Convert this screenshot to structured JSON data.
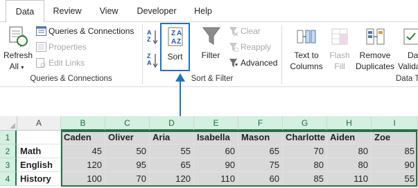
{
  "tabs": [
    "Data",
    "Review",
    "View",
    "Developer",
    "Help"
  ],
  "active_tab": "Data",
  "ribbon": {
    "refresh_label": "Refresh",
    "refresh_all_label": "All",
    "queries_connections": "Queries & Connections",
    "properties": "Properties",
    "edit_links": "Edit Links",
    "group_queries": "Queries & Connections",
    "sort_label": "Sort",
    "filter_label": "Filter",
    "clear_label": "Clear",
    "reapply_label": "Reapply",
    "advanced_label": "Advanced",
    "group_sort_filter": "Sort & Filter",
    "text_to_label": "Text to",
    "columns_label": "Columns",
    "flash_label": "Flash",
    "fill_label": "Fill",
    "remove_label": "Remove",
    "duplicates_label": "Duplicates",
    "data_val_1": "Da",
    "data_val_2": "Valida",
    "group_data_tools": "Data T",
    "sort_az_top": "A",
    "sort_az_bottom": "Z",
    "sort_za_top": "Z",
    "sort_za_bottom": "A"
  },
  "sheet": {
    "columns": [
      "A",
      "B",
      "C",
      "D",
      "E",
      "F",
      "G",
      "H",
      "I"
    ],
    "selected_columns": [
      "B",
      "C",
      "D",
      "E",
      "F",
      "G",
      "H",
      "I"
    ],
    "rows": [
      "1",
      "2",
      "3",
      "4"
    ],
    "header_row": [
      "",
      "Caden",
      "Oliver",
      "Aria",
      "Isabella",
      "Mason",
      "Charlotte",
      "Aiden",
      "Zoe"
    ],
    "data_rows": [
      {
        "label": "Math",
        "values": [
          "45",
          "50",
          "55",
          "60",
          "65",
          "70",
          "80",
          "85"
        ]
      },
      {
        "label": "English",
        "values": [
          "120",
          "95",
          "65",
          "90",
          "75",
          "80",
          "80",
          "90"
        ]
      },
      {
        "label": "History",
        "values": [
          "100",
          "70",
          "120",
          "110",
          "60",
          "85",
          "110",
          "55"
        ]
      }
    ]
  },
  "colors": {
    "excel_green": "#217346",
    "highlight_blue": "#1a73c9",
    "selection_fill": "#d9d9d9"
  }
}
